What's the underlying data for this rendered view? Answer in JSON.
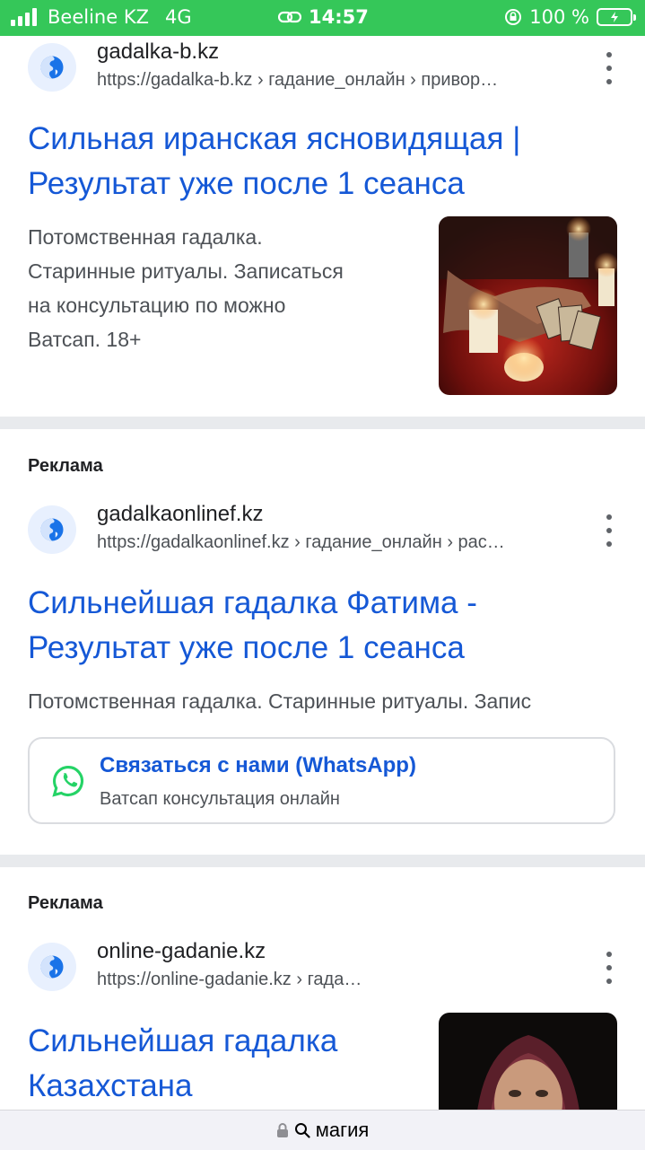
{
  "status_bar": {
    "carrier": "Beeline KZ",
    "network": "4G",
    "time": "14:57",
    "battery": "100 %"
  },
  "results": [
    {
      "ad_label": "",
      "site_name": "gadalka-b.kz",
      "url": "https://gadalka-b.kz › гадание_онлайн › привор…",
      "title_line1": "Сильная иранская ясновидящая |",
      "title_line2": "Результат уже после 1 сеанса",
      "desc_lines": [
        "Потомственная гадалка.",
        "Старинные ритуалы. Записаться",
        "на консультацию по можно",
        "Ватсап. 18+"
      ],
      "image": "fortune-teller-candles-image"
    },
    {
      "ad_label": "Реклама",
      "site_name": "gadalkaonlinef.kz",
      "url": "https://gadalkaonlinef.kz › гадание_онлайн › рас…",
      "title_line1": "Сильнейшая гадалка Фатима -",
      "title_line2": "Результат уже после 1 сеанса",
      "desc_lines": [
        "Потомственная гадалка. Старинные ритуалы. Запис"
      ],
      "sitelink": {
        "icon": "whatsapp-icon",
        "title": "Связаться с нами (WhatsApp)",
        "subtitle": "Ватсап консультация онлайн"
      }
    },
    {
      "ad_label": "Реклама",
      "site_name": "online-gadanie.kz",
      "url": "https://online-gadanie.kz › гада…",
      "title_line1": "Сильнейшая гадалка",
      "title_line2": "Казахстана",
      "image": "woman-portrait-image"
    }
  ],
  "bottom_bar": {
    "query": "магия"
  },
  "colors": {
    "status_bar": "#35c759",
    "link": "#1558d6",
    "whatsapp": "#25d366"
  }
}
